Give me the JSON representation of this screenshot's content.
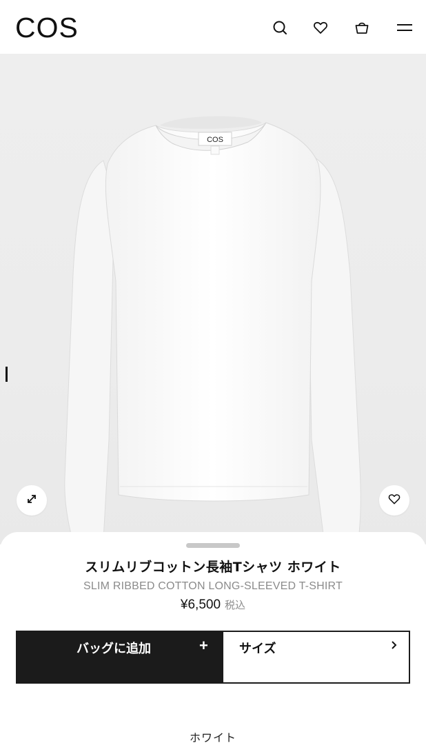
{
  "brand": {
    "logo": "COS"
  },
  "header": {
    "icons": [
      "search-icon",
      "heart-icon",
      "bag-icon",
      "menu-icon"
    ]
  },
  "product_image": {
    "garment_label": "COS",
    "expand_icon": "expand-icon",
    "wishlist_icon": "heart-icon"
  },
  "product": {
    "name_jp": "スリムリブコットン長袖Tシャツ ホワイト",
    "name_en": "SLIM RIBBED COTTON LONG-SLEEVED T-SHIRT",
    "price": "¥6,500",
    "tax_note": "税込",
    "color": "ホワイト"
  },
  "actions": {
    "add_to_bag": "バッグに追加",
    "add_plus": "+",
    "size": "サイズ",
    "size_chevron": "›"
  },
  "colors": {
    "button_dark": "#1b1b1b",
    "background_image": "#ececec",
    "muted_text": "#8b8b8b"
  }
}
